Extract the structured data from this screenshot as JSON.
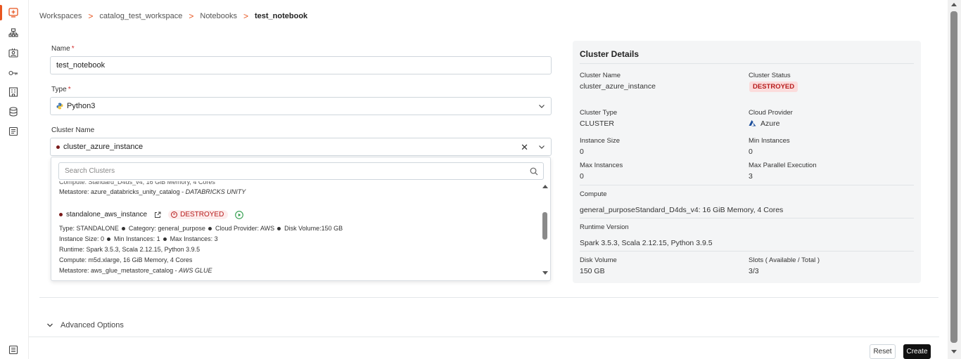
{
  "breadcrumb": {
    "items": [
      "Workspaces",
      "catalog_test_workspace",
      "Notebooks"
    ],
    "current": "test_notebook",
    "separator": ">"
  },
  "form": {
    "name": {
      "label": "Name",
      "required": "*",
      "value": "test_notebook"
    },
    "type": {
      "label": "Type",
      "required": "*",
      "value": "Python3"
    },
    "cluster": {
      "label": "Cluster Name",
      "value": "cluster_azure_instance",
      "clear": "✕"
    }
  },
  "dropdown": {
    "search_placeholder": "Search Clusters",
    "partial_line": "Compute: Standard_D4ds_v4, 16 GiB Memory, 4 Cores",
    "prev_metastore": {
      "prefix": "Metastore: azure_databricks_unity_catalog - ",
      "type": "DATABRICKS UNITY"
    },
    "option": {
      "name": "standalone_aws_instance",
      "status": "DESTROYED",
      "type_line": {
        "type": "Type: STANDALONE",
        "category": "Category: general_purpose",
        "provider": "Cloud Provider: AWS",
        "disk": "Disk Volume:150 GB"
      },
      "instances_line": {
        "size": "Instance Size: 0",
        "min": "Min Instances: 1",
        "max": "Max Instances: 3"
      },
      "runtime": "Runtime: Spark 3.5.3, Scala 2.12.15, Python 3.9.5",
      "compute": "Compute: m5d.xlarge, 16 GiB Memory, 4 Cores",
      "metastore": {
        "prefix": "Metastore: aws_glue_metastore_catalog - ",
        "type": "AWS GLUE"
      }
    }
  },
  "details": {
    "title": "Cluster Details",
    "cluster_name_label": "Cluster Name",
    "cluster_name": "cluster_azure_instance",
    "cluster_status_label": "Cluster Status",
    "cluster_status": "DESTROYED",
    "cluster_type_label": "Cluster Type",
    "cluster_type": "CLUSTER",
    "cloud_provider_label": "Cloud Provider",
    "cloud_provider": "Azure",
    "instance_size_label": "Instance Size",
    "instance_size": "0",
    "min_instances_label": "Min Instances",
    "min_instances": "0",
    "max_instances_label": "Max Instances",
    "max_instances": "0",
    "max_parallel_label": "Max Parallel Execution",
    "max_parallel": "3",
    "compute_label": "Compute",
    "compute": "general_purposeStandard_D4ds_v4:  16 GiB Memory,  4 Cores",
    "runtime_label": "Runtime Version",
    "runtime": "Spark 3.5.3, Scala 2.12.15, Python 3.9.5",
    "disk_label": "Disk Volume",
    "disk": "150 GB",
    "slots_label": "Slots ( Available / Total )",
    "slots": "3/3"
  },
  "advanced_options": "Advanced Options",
  "buttons": {
    "reset": "Reset",
    "create": "Create"
  },
  "colors": {
    "accent": "#e8551f",
    "danger": "#b71c1c",
    "danger_bg": "#fbdcdc",
    "primary_button": "#111111",
    "card_bg": "#f4f5f6"
  }
}
